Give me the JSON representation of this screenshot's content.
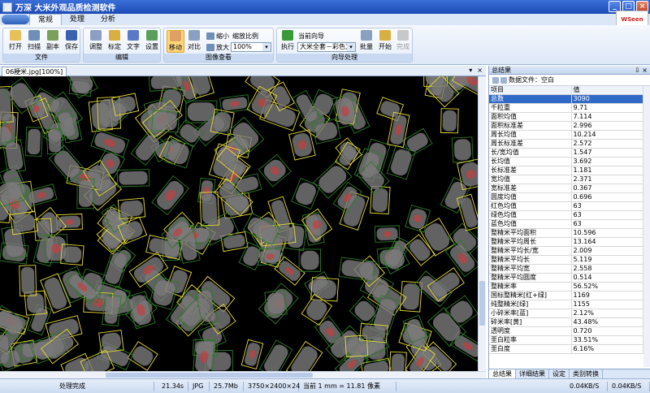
{
  "window": {
    "title": "万深  大米外观品质检测软件",
    "min": "_",
    "max": "□",
    "close": "×"
  },
  "logo": "WSeen",
  "ribbon_tabs": [
    "常规",
    "处理",
    "分析"
  ],
  "groups": {
    "file": {
      "label": "文件",
      "buttons": [
        "打开",
        "扫描",
        "副本",
        "保存"
      ]
    },
    "edit": {
      "label": "编辑",
      "buttons": [
        "调整",
        "标定",
        "文字",
        "设置"
      ]
    },
    "view": {
      "label": "图像查看",
      "buttons": [
        "移动",
        "对比"
      ],
      "shrink": "缩小",
      "enlarge": "放大",
      "zoom_label": "缩放比例",
      "zoom_value": "100%"
    },
    "wizard": {
      "label": "向导处理",
      "run": "执行",
      "current_label": "当前向导",
      "current_value": "大米全套－彩色方",
      "batch": "批量",
      "start": "开始",
      "finish": "完成"
    }
  },
  "doc_tab": "06粳米.jpg[100%]",
  "doc_tab_controls": {
    "arrow": "▾",
    "close": "×"
  },
  "panel": {
    "title": "总结果",
    "title_controls": "⇩ ×",
    "datafile": "数据文件：空白",
    "col_item": "项目",
    "col_value": "值",
    "rows": [
      [
        "总数",
        "3090"
      ],
      [
        "千粒重",
        "9.71"
      ],
      [
        "面积均值",
        "7.114"
      ],
      [
        "面积标准差",
        "2.996"
      ],
      [
        "周长均值",
        "10.214"
      ],
      [
        "周长标准差",
        "2.572"
      ],
      [
        "长/宽均值",
        "1.547"
      ],
      [
        "长均值",
        "3.692"
      ],
      [
        "长标准差",
        "1.181"
      ],
      [
        "宽均值",
        "2.371"
      ],
      [
        "宽标准差",
        "0.367"
      ],
      [
        "圆度均值",
        "0.696"
      ],
      [
        "红色均值",
        "63"
      ],
      [
        "绿色均值",
        "63"
      ],
      [
        "蓝色均值",
        "63"
      ],
      [
        "整精米平均面积",
        "10.596"
      ],
      [
        "整精米平均周长",
        "13.164"
      ],
      [
        "整精米平均长/宽",
        "2.009"
      ],
      [
        "整精米平均长",
        "5.119"
      ],
      [
        "整精米平均宽",
        "2.558"
      ],
      [
        "整精米平均圆度",
        "0.514"
      ],
      [
        "整精米率",
        "56.52%"
      ],
      [
        "国标整精米[红+绿]",
        "1169"
      ],
      [
        "纯整精米[绿]",
        "1155"
      ],
      [
        "小碎米率[蓝]",
        "2.12%"
      ],
      [
        "碎米率[黄]",
        "43.48%"
      ],
      [
        "透明度",
        "0.720"
      ],
      [
        "垩白粒率",
        "33.51%"
      ],
      [
        "垩白度",
        "6.16%"
      ]
    ],
    "tabs": [
      "总结果",
      "详细结果",
      "设定",
      "类别转换"
    ]
  },
  "status": {
    "state": "处理完成",
    "time": "21.34s",
    "format": "JPG",
    "size": "25.7Mb",
    "dims": "3750×2400×24",
    "scale": "当前 1 mm = 11.81 像素",
    "net_up": "0.04KB/S",
    "net_down": "0.04KB/S"
  },
  "colors": {
    "grain_fill": "#7a7a7a",
    "box_yellow": "#e8dc3a",
    "box_green": "#2f7a2a",
    "chalky": "#c04040"
  }
}
